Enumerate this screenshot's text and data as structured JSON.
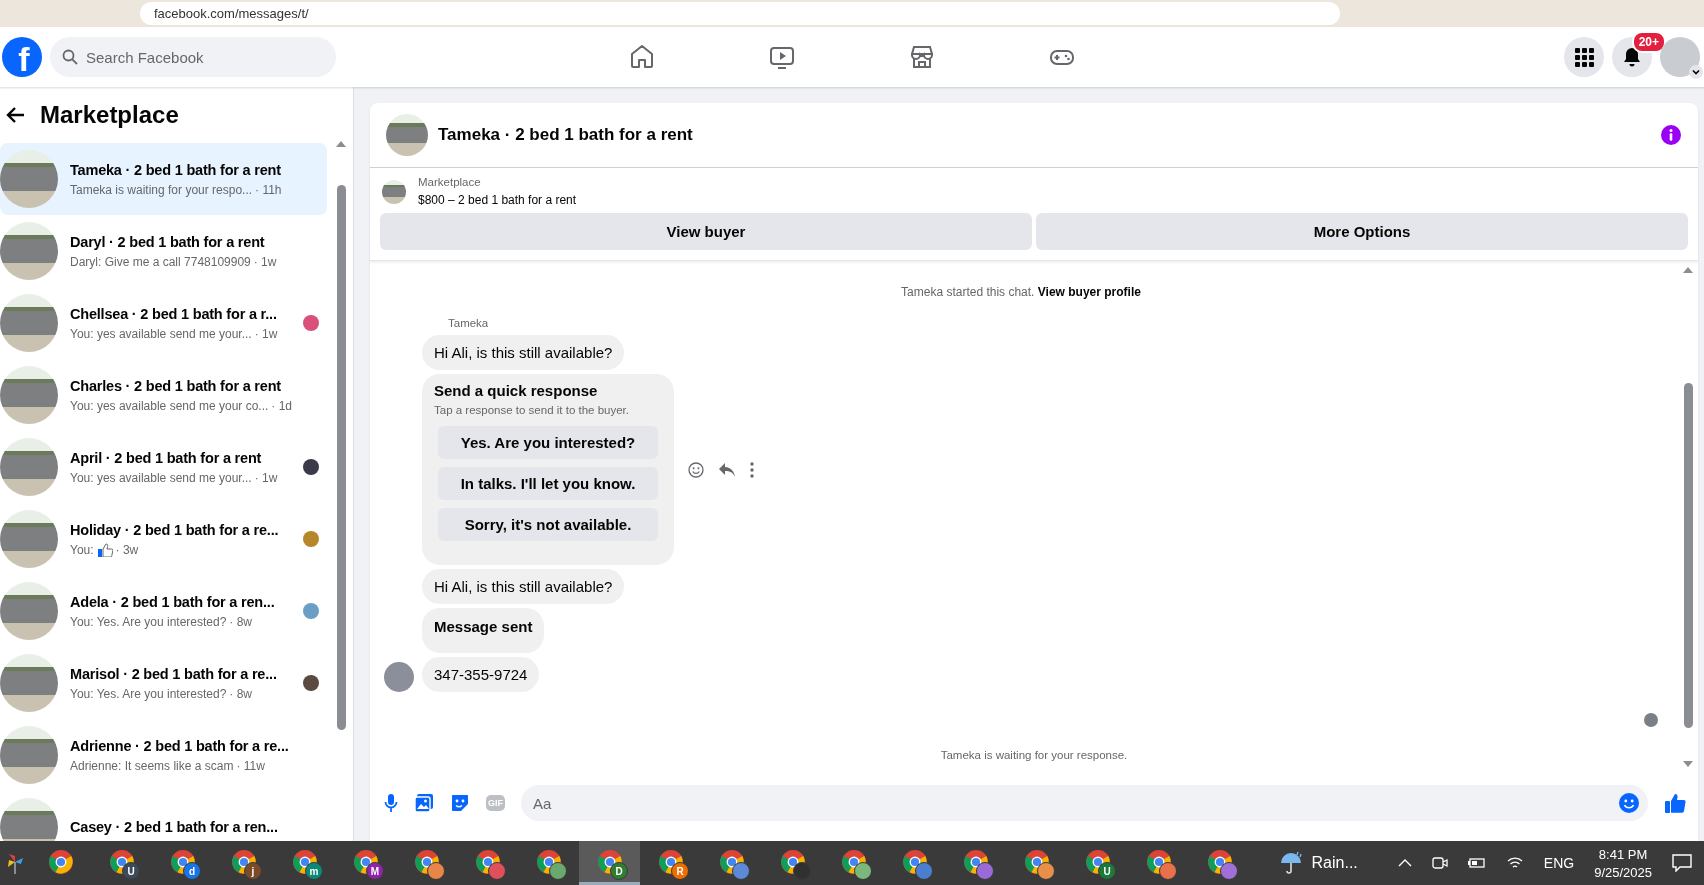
{
  "browser": {
    "url": "facebook.com/messages/t/"
  },
  "header": {
    "logo": "f",
    "search": {
      "placeholder": "Search Facebook"
    },
    "nav": [
      {
        "kind": "home",
        "selected": false
      },
      {
        "kind": "video",
        "selected": false
      },
      {
        "kind": "marketplace",
        "selected": false
      },
      {
        "kind": "gaming",
        "selected": false
      }
    ],
    "notifications": "20+"
  },
  "sidebar": {
    "title": "Marketplace",
    "conversations": [
      {
        "title": "Tameka · 2 bed 1 bath for a rent",
        "preview": "Tameka is waiting for your respo...",
        "time": "· 11h",
        "selected": true
      },
      {
        "title": "Daryl · 2 bed 1 bath for a rent",
        "preview": "Daryl: Give me a call 7748109909",
        "time": "· 1w",
        "selected": false
      },
      {
        "title": "Chellsea · 2 bed 1 bath for a r...",
        "preview": "You: yes available send me your...",
        "time": "· 1w",
        "selected": false,
        "color": "#d9507a"
      },
      {
        "title": "Charles · 2 bed 1 bath for a rent",
        "preview": "You: yes available send me your co...",
        "time": "· 1d",
        "selected": false
      },
      {
        "title": "April · 2 bed 1 bath for a rent",
        "preview": "You: yes available send me your...",
        "time": "· 1w",
        "selected": false,
        "color": "#3a3a48"
      },
      {
        "title": "Holiday · 2 bed 1 bath for a re...",
        "preview": "You:",
        "like": true,
        "time": "· 3w",
        "selected": false,
        "color": "#b8862a"
      },
      {
        "title": "Adela · 2 bed 1 bath for a ren...",
        "preview": "You: Yes. Are you interested?",
        "time": "· 8w",
        "selected": false,
        "color": "#6a9ec4"
      },
      {
        "title": "Marisol · 2 bed 1 bath for a re...",
        "preview": "You: Yes. Are you interested?",
        "time": "· 8w",
        "selected": false,
        "color": "#5a4a40"
      },
      {
        "title": "Adrienne · 2 bed 1 bath for a re...",
        "preview": "Adrienne: It seems like a scam",
        "time": "· 11w",
        "selected": false
      },
      {
        "title": "Casey · 2 bed 1 bath for a ren...",
        "selected": false
      }
    ]
  },
  "chat": {
    "title": "Tameka · 2 bed 1 bath for a rent",
    "listing": {
      "label": "Marketplace",
      "summary": "$800 – 2 bed 1 bath for a rent"
    },
    "buttons": [
      "View buyer",
      "More Options"
    ],
    "intro": {
      "text": "Tameka started this chat.",
      "link": "View buyer profile"
    },
    "sender": "Tameka",
    "messages": [
      {
        "kind": "text",
        "text": "Hi Ali, is this still available?"
      },
      {
        "kind": "quick_replies",
        "title": "Send a quick response",
        "subtitle": "Tap a response to send it to the buyer.",
        "options": [
          "Yes. Are you interested?",
          "In talks. I'll let you know.",
          "Sorry, it's not available."
        ],
        "hovered": true
      },
      {
        "kind": "text",
        "text": "Hi Ali, is this still available?"
      },
      {
        "kind": "notice",
        "text": "Message sent"
      },
      {
        "kind": "text",
        "text": "347-355-9724",
        "avatar": true
      }
    ],
    "status": "Tameka is waiting for your response.",
    "composer": {
      "gif": "GIF",
      "placeholder": "Aa"
    }
  },
  "taskbar": {
    "apps": [
      {
        "selected": false
      },
      {
        "badge": "U",
        "color": "#3c4a5a",
        "selected": false
      },
      {
        "badge": "d",
        "color": "#1a73e8",
        "selected": false
      },
      {
        "badge": "j",
        "color": "#7a4a2a",
        "selected": false
      },
      {
        "badge": "m",
        "color": "#0b8a7a",
        "selected": false
      },
      {
        "badge": "M",
        "color": "#8e24aa",
        "selected": false
      },
      {
        "color": "#e8864a",
        "selected": false
      },
      {
        "color": "#e0505a",
        "selected": false
      },
      {
        "color": "#6aa870",
        "selected": false
      },
      {
        "badge": "D",
        "color": "#2e7d32",
        "selected": true
      },
      {
        "badge": "R",
        "color": "#ef6c00",
        "selected": false
      },
      {
        "color": "#5c8ad8",
        "selected": false
      },
      {
        "color": "#303030",
        "selected": false
      },
      {
        "color": "#7cb87c",
        "selected": false
      },
      {
        "color": "#4a7fd0",
        "selected": false
      },
      {
        "color": "#9a6ad8",
        "selected": false
      },
      {
        "color": "#e8904a",
        "selected": false
      },
      {
        "badge": "U",
        "color": "#1b7a3a",
        "selected": false
      },
      {
        "color": "#e8704a",
        "selected": false
      },
      {
        "color": "#a070d8",
        "selected": false
      }
    ],
    "weather": "Rain...",
    "language": "ENG",
    "time": "8:41 PM",
    "date": "9/25/2025"
  }
}
